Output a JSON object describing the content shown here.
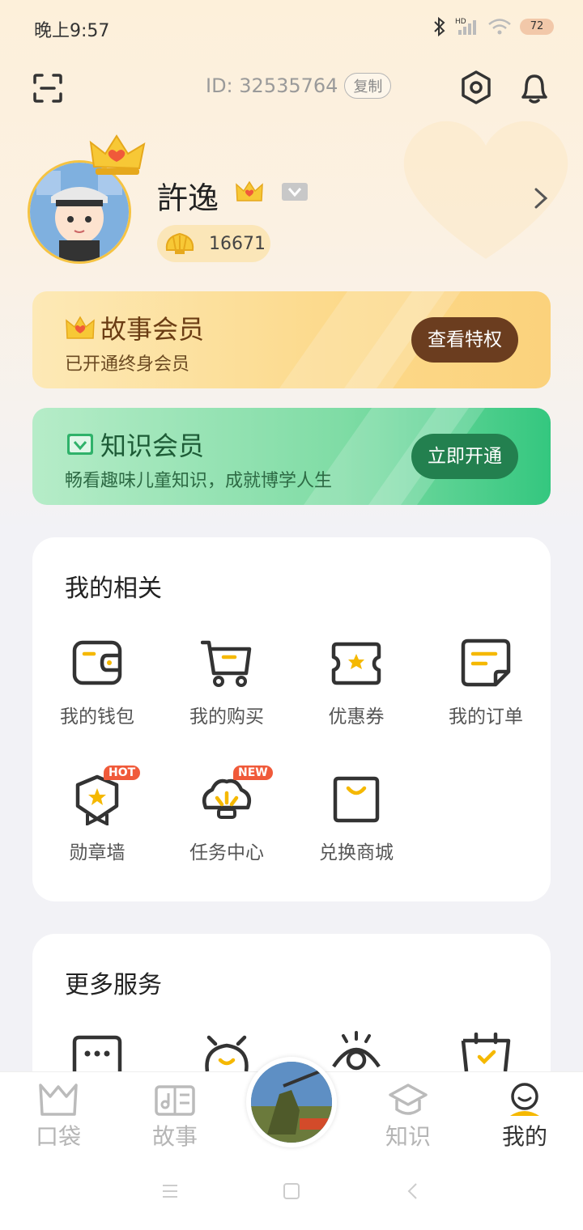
{
  "status_bar": {
    "time": "晚上9:57",
    "battery": "72"
  },
  "header": {
    "id_label": "ID: 32535764",
    "copy_label": "复制"
  },
  "profile": {
    "username": "許逸",
    "shells": "16671"
  },
  "membership": {
    "story": {
      "title": "故事会员",
      "subtitle": "已开通终身会员",
      "button": "查看特权"
    },
    "knowledge": {
      "title": "知识会员",
      "subtitle": "畅看趣味儿童知识，成就博学人生",
      "button": "立即开通"
    }
  },
  "related": {
    "title": "我的相关",
    "items": [
      {
        "label": "我的钱包",
        "icon": "wallet-icon"
      },
      {
        "label": "我的购买",
        "icon": "cart-icon"
      },
      {
        "label": "优惠券",
        "icon": "coupon-icon"
      },
      {
        "label": "我的订单",
        "icon": "order-icon"
      },
      {
        "label": "勋章墙",
        "icon": "medal-icon",
        "tag": "HOT"
      },
      {
        "label": "任务中心",
        "icon": "task-icon",
        "tag": "NEW"
      },
      {
        "label": "兑换商城",
        "icon": "shop-bag-icon"
      }
    ]
  },
  "more": {
    "title": "更多服务"
  },
  "bottom_nav": {
    "items": [
      {
        "label": "口袋",
        "icon": "pocket-icon"
      },
      {
        "label": "故事",
        "icon": "story-book-icon"
      },
      {
        "label": "知识",
        "icon": "graduation-cap-icon"
      },
      {
        "label": "我的",
        "icon": "profile-icon",
        "active": true
      }
    ]
  },
  "colors": {
    "accent_gold": "#f5c342",
    "story_button": "#6b3d1f",
    "knowledge_button": "#23804f",
    "tag_red": "#f05a3a"
  }
}
